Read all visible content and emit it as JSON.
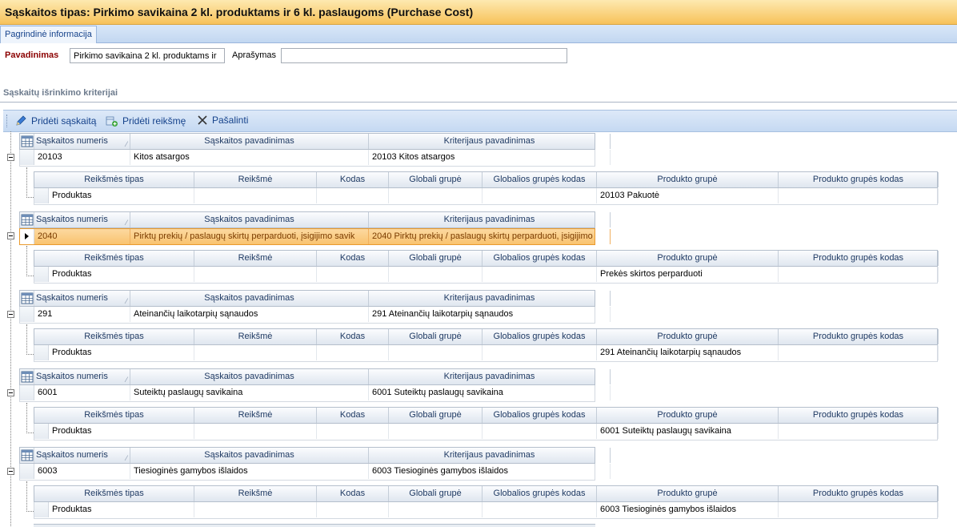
{
  "window": {
    "title": "Sąskaitos tipas: Pirkimo savikaina 2 kl. produktams ir 6 kl. paslaugoms (Purchase Cost)"
  },
  "tabs": [
    {
      "label": "Pagrindinė informacija"
    }
  ],
  "form": {
    "name_label": "Pavadinimas",
    "name_value": "Pirkimo savikaina 2 kl. produktams ir",
    "description_label": "Aprašymas",
    "description_value": ""
  },
  "section": {
    "title": "Sąskaitų išrinkimo kriterijai"
  },
  "toolbar": {
    "add_account_label": "Pridėti sąskaitą",
    "add_value_label": "Pridėti reikšmę",
    "remove_label": "Pašalinti"
  },
  "parent_columns": [
    "Sąskaitos numeris",
    "Sąskaitos pavadinimas",
    "Kriterijaus pavadinimas"
  ],
  "child_columns": [
    "Reikšmės tipas",
    "Reikšmė",
    "Kodas",
    "Globali grupė",
    "Globalios grupės kodas",
    "Produkto grupė",
    "Produkto grupės kodas"
  ],
  "groups": [
    {
      "account_number": "20103",
      "account_name": "Kitos atsargos",
      "criterion_name": "20103 Kitos atsargos",
      "child": {
        "value_type": "Produktas",
        "value": "",
        "code": "",
        "global_group": "",
        "global_group_code": "",
        "product_group": "20103 Pakuotė",
        "product_group_code": ""
      }
    },
    {
      "account_number": "2040",
      "account_name": "Pirktų prekių / paslaugų skirtų perparduoti, įsigijimo savik",
      "criterion_name": "2040 Pirktų prekių / paslaugų skirtų perparduoti, įsigijimo",
      "selected": true,
      "child": {
        "value_type": "Produktas",
        "value": "",
        "code": "",
        "global_group": "",
        "global_group_code": "",
        "product_group": "Prekės skirtos perparduoti",
        "product_group_code": ""
      }
    },
    {
      "account_number": "291",
      "account_name": "Ateinančių laikotarpių sąnaudos",
      "criterion_name": "291 Ateinančių laikotarpių sąnaudos",
      "child": {
        "value_type": "Produktas",
        "value": "",
        "code": "",
        "global_group": "",
        "global_group_code": "",
        "product_group": "291 Ateinančių laikotarpių sąnaudos",
        "product_group_code": ""
      }
    },
    {
      "account_number": "6001",
      "account_name": "Suteiktų  paslaugų savikaina",
      "criterion_name": "6001 Suteiktų  paslaugų savikaina",
      "child": {
        "value_type": "Produktas",
        "value": "",
        "code": "",
        "global_group": "",
        "global_group_code": "",
        "product_group": "6001 Suteiktų  paslaugų savikaina",
        "product_group_code": ""
      }
    },
    {
      "account_number": "6003",
      "account_name": "Tiesioginės gamybos išlaidos",
      "criterion_name": "6003 Tiesioginės gamybos išlaidos",
      "child": {
        "value_type": "Produktas",
        "value": "",
        "code": "",
        "global_group": "",
        "global_group_code": "",
        "product_group": "6003 Tiesioginės gamybos išlaidos",
        "product_group_code": ""
      }
    }
  ],
  "colors": {
    "title_bar": "#f7c25a",
    "selected_row": "#f9c36f",
    "required_label": "#8b0000",
    "link_text": "#15428b"
  }
}
